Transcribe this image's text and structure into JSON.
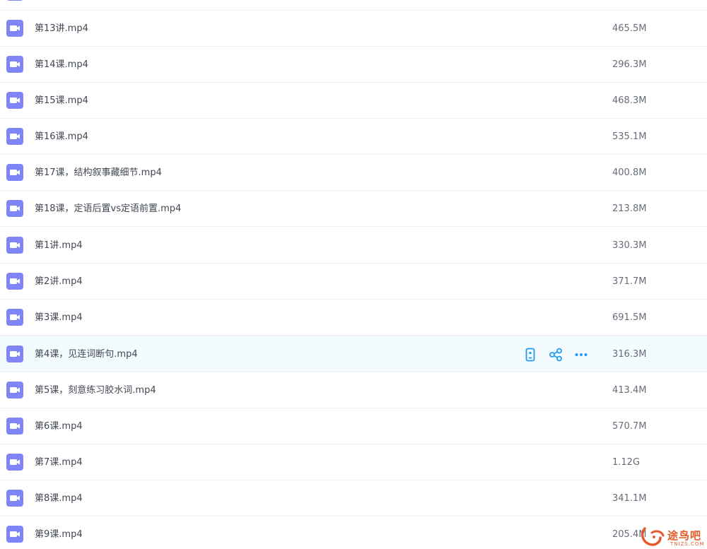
{
  "files": [
    {
      "name": "",
      "size": ""
    },
    {
      "name": "第13讲.mp4",
      "size": "465.5M"
    },
    {
      "name": "第14课.mp4",
      "size": "296.3M"
    },
    {
      "name": "第15课.mp4",
      "size": "468.3M"
    },
    {
      "name": "第16课.mp4",
      "size": "535.1M"
    },
    {
      "name": "第17课，结构叙事藏细节.mp4",
      "size": "400.8M"
    },
    {
      "name": "第18课，定语后置vs定语前置.mp4",
      "size": "213.8M"
    },
    {
      "name": "第1讲.mp4",
      "size": "330.3M"
    },
    {
      "name": "第2讲.mp4",
      "size": "371.7M"
    },
    {
      "name": "第3课.mp4",
      "size": "691.5M"
    },
    {
      "name": "第4课，见连词断句.mp4",
      "size": "316.3M"
    },
    {
      "name": "第5课，刻意练习胶水词.mp4",
      "size": "413.4M"
    },
    {
      "name": "第6课.mp4",
      "size": "570.7M"
    },
    {
      "name": "第7课.mp4",
      "size": "1.12G"
    },
    {
      "name": "第8课.mp4",
      "size": "341.1M"
    },
    {
      "name": "第9课.mp4",
      "size": "205.4M"
    }
  ],
  "hovered_row_actions": {
    "icons": [
      "phone-icon",
      "share-icon",
      "more-icon"
    ]
  },
  "watermark": {
    "text": "途鸟吧",
    "sub": "TNIZS.COM"
  },
  "colors": {
    "file_icon": "#7f84f6",
    "action_icon": "#1e9bf0",
    "hover_row": "#f4fbff",
    "watermark": "#e45b2a"
  }
}
